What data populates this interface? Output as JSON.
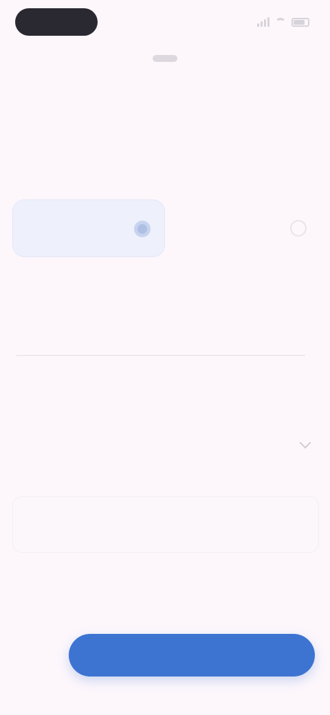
{
  "status_bar": {
    "time": "",
    "signal_icon": "signal-icon",
    "wifi_icon": "wifi-icon",
    "battery_icon": "battery-icon"
  },
  "nav": {
    "handle": ""
  },
  "form": {
    "eyebrow": "",
    "title": "",
    "subtitle": "",
    "options": [
      {
        "label": "",
        "selected": true
      },
      {
        "label": "",
        "selected": false
      }
    ],
    "field1": {
      "label": "",
      "value": ""
    },
    "field2": {
      "label": "",
      "value": ""
    },
    "field3": {
      "label": "",
      "placeholder": ""
    }
  },
  "footer": {
    "back_label": "",
    "primary_label": ""
  },
  "colors": {
    "background": "#fdf7fc",
    "primary": "#3d74d2",
    "selected_chip": "#eef0fb"
  }
}
